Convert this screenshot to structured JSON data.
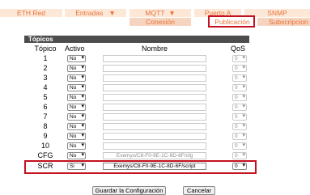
{
  "menu": {
    "tabs": [
      "ETH Red",
      "Entradas",
      "MQTT",
      "Puerto A",
      "SNMP"
    ],
    "dropdown_glyph": "▼",
    "subtabs": [
      "Conexión",
      "Publicación",
      "Subscripcion"
    ]
  },
  "panel": {
    "title": "Tópicos"
  },
  "columns": {
    "topic": "Tópico",
    "active": "Activo",
    "name": "Nombre",
    "qos": "QoS"
  },
  "rows": [
    {
      "label": "1",
      "active": "No",
      "name": "",
      "qos": "0"
    },
    {
      "label": "2",
      "active": "No",
      "name": "",
      "qos": "0"
    },
    {
      "label": "3",
      "active": "No",
      "name": "",
      "qos": "0"
    },
    {
      "label": "4",
      "active": "No",
      "name": "",
      "qos": "0"
    },
    {
      "label": "5",
      "active": "No",
      "name": "",
      "qos": "0"
    },
    {
      "label": "6",
      "active": "No",
      "name": "",
      "qos": "0"
    },
    {
      "label": "7",
      "active": "No",
      "name": "",
      "qos": "0"
    },
    {
      "label": "8",
      "active": "No",
      "name": "",
      "qos": "0"
    },
    {
      "label": "9",
      "active": "No",
      "name": "",
      "qos": "0"
    },
    {
      "label": "10",
      "active": "No",
      "name": "",
      "qos": "0"
    },
    {
      "label": "CFG",
      "active": "No",
      "name": "Exemys/C8-F0-9E-1C-8D-6F/cfg",
      "qos": "0"
    },
    {
      "label": "SCR",
      "active": "Si",
      "name": "Exemys/C8-F0-9E-1C-8D-6F/script",
      "qos": "0"
    }
  ],
  "buttons": {
    "save": "Guardar la Configuración",
    "cancel": "Cancelar"
  },
  "colors": {
    "accent": "#e8733b",
    "tab_bg": "#fde8d8",
    "highlight": "#c4101f",
    "panel_header": "#4d4d4d"
  }
}
